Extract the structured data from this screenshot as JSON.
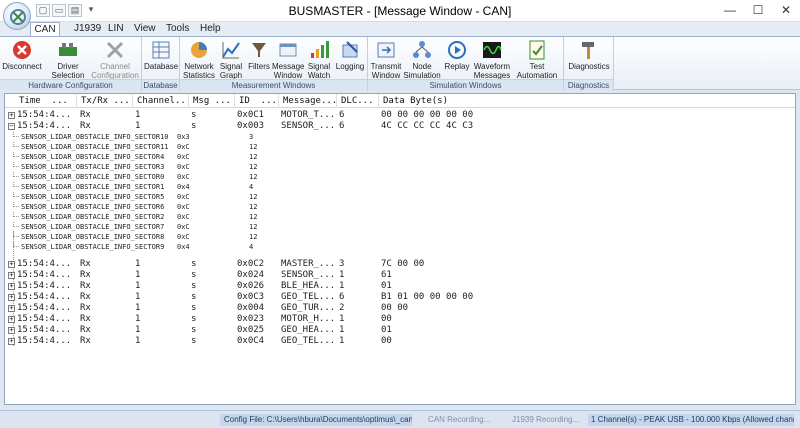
{
  "window": {
    "title": "BUSMASTER - [Message Window - CAN]",
    "minimize": "—",
    "maximize": "☐",
    "close": "✕"
  },
  "qat": {
    "new": "▢",
    "open": "▭",
    "save": "▤",
    "more": "▾"
  },
  "tabs": [
    "CAN",
    "J1939",
    "LIN",
    "View",
    "Tools",
    "Help"
  ],
  "ribbon": {
    "groups": [
      {
        "label": "Hardware Configuration",
        "buttons": [
          "Disconnect",
          "Driver Selection",
          "Channel Configuration"
        ]
      },
      {
        "label": "Database",
        "buttons": [
          "Database"
        ]
      },
      {
        "label": "Measurement Windows",
        "buttons": [
          "Network Statistics",
          "Signal Graph",
          "Filters",
          "Message Window",
          "Signal Watch",
          "Logging"
        ]
      },
      {
        "label": "Simulation Windows",
        "buttons": [
          "Transmit Window",
          "Node Simulation",
          "Replay",
          "Waveform Messages",
          "Test Automation Executor"
        ]
      },
      {
        "label": "Diagnostics",
        "buttons": [
          "Diagnostics"
        ]
      }
    ]
  },
  "table": {
    "headers": [
      "Time",
      "Tx/Rx",
      "Channel",
      "Msg",
      "ID",
      "Message",
      "DLC",
      "Data Byte(s)"
    ],
    "rows_top": [
      {
        "exp": "+",
        "time": "15:54:4...",
        "txrx": "Rx",
        "ch": "1",
        "type": "s",
        "id": "0x0C1",
        "name": "MOTOR_T...",
        "dlc": "6",
        "data": "00 00 00 00 00 00"
      },
      {
        "exp": "−",
        "time": "15:54:4...",
        "txrx": "Rx",
        "ch": "1",
        "type": "s",
        "id": "0x003",
        "name": "SENSOR_...",
        "dlc": "6",
        "data": "4C CC CC CC 4C C3"
      }
    ],
    "signals": [
      {
        "name": "SENSOR_LIDAR_OBSTACLE_INFO_SECTOR10",
        "raw": "0x3",
        "val": "3"
      },
      {
        "name": "SENSOR_LIDAR_OBSTACLE_INFO_SECTOR11",
        "raw": "0xC",
        "val": "12"
      },
      {
        "name": "SENSOR_LIDAR_OBSTACLE_INFO_SECTOR4",
        "raw": "0xC",
        "val": "12"
      },
      {
        "name": "SENSOR_LIDAR_OBSTACLE_INFO_SECTOR3",
        "raw": "0xC",
        "val": "12"
      },
      {
        "name": "SENSOR_LIDAR_OBSTACLE_INFO_SECTOR0",
        "raw": "0xC",
        "val": "12"
      },
      {
        "name": "SENSOR_LIDAR_OBSTACLE_INFO_SECTOR1",
        "raw": "0x4",
        "val": "4"
      },
      {
        "name": "SENSOR_LIDAR_OBSTACLE_INFO_SECTOR5",
        "raw": "0xC",
        "val": "12"
      },
      {
        "name": "SENSOR_LIDAR_OBSTACLE_INFO_SECTOR6",
        "raw": "0xC",
        "val": "12"
      },
      {
        "name": "SENSOR_LIDAR_OBSTACLE_INFO_SECTOR2",
        "raw": "0xC",
        "val": "12"
      },
      {
        "name": "SENSOR_LIDAR_OBSTACLE_INFO_SECTOR7",
        "raw": "0xC",
        "val": "12"
      },
      {
        "name": "SENSOR_LIDAR_OBSTACLE_INFO_SECTOR8",
        "raw": "0xC",
        "val": "12"
      },
      {
        "name": "SENSOR_LIDAR_OBSTACLE_INFO_SECTOR9",
        "raw": "0x4",
        "val": "4"
      }
    ],
    "rows_bottom": [
      {
        "exp": "+",
        "time": "15:54:4...",
        "txrx": "Rx",
        "ch": "1",
        "type": "s",
        "id": "0x0C2",
        "name": "MASTER_...",
        "dlc": "3",
        "data": "7C 00 00"
      },
      {
        "exp": "+",
        "time": "15:54:4...",
        "txrx": "Rx",
        "ch": "1",
        "type": "s",
        "id": "0x024",
        "name": "SENSOR_...",
        "dlc": "1",
        "data": "61"
      },
      {
        "exp": "+",
        "time": "15:54:4...",
        "txrx": "Rx",
        "ch": "1",
        "type": "s",
        "id": "0x026",
        "name": "BLE_HEA...",
        "dlc": "1",
        "data": "01"
      },
      {
        "exp": "+",
        "time": "15:54:4...",
        "txrx": "Rx",
        "ch": "1",
        "type": "s",
        "id": "0x0C3",
        "name": "GEO_TEL...",
        "dlc": "6",
        "data": "B1 01 00 00 00 00"
      },
      {
        "exp": "+",
        "time": "15:54:4...",
        "txrx": "Rx",
        "ch": "1",
        "type": "s",
        "id": "0x004",
        "name": "GEO_TUR...",
        "dlc": "2",
        "data": "00 00"
      },
      {
        "exp": "+",
        "time": "15:54:4...",
        "txrx": "Rx",
        "ch": "1",
        "type": "s",
        "id": "0x023",
        "name": "MOTOR_H...",
        "dlc": "1",
        "data": "00"
      },
      {
        "exp": "+",
        "time": "15:54:4...",
        "txrx": "Rx",
        "ch": "1",
        "type": "s",
        "id": "0x025",
        "name": "GEO_HEA...",
        "dlc": "1",
        "data": "01"
      },
      {
        "exp": "+",
        "time": "15:54:4...",
        "txrx": "Rx",
        "ch": "1",
        "type": "s",
        "id": "0x0C4",
        "name": "GEO_TEL...",
        "dlc": "1",
        "data": "00"
      }
    ]
  },
  "status": {
    "config": "Config File: C:\\Users\\hbura\\Documents\\optimus\\_can_dbc\\",
    "can_rec": "CAN Recording...",
    "j1939_rec": "J1939 Recording...",
    "channel": "1 Channel(s) - PEAK USB - 100.000 Kbps (Allowed channels:16)"
  },
  "colors": {
    "accent": "#2b579a",
    "title_bg": "#ffffff",
    "ribbon_bg": "#e9eff7"
  }
}
